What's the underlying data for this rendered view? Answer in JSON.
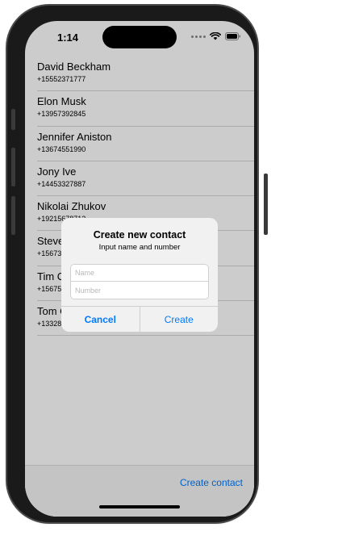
{
  "status_bar": {
    "time": "1:14"
  },
  "contacts": [
    {
      "name": "David Beckham",
      "phone": "+15552371777"
    },
    {
      "name": "Elon Musk",
      "phone": "+13957392845"
    },
    {
      "name": "Jennifer Aniston",
      "phone": "+13674551990"
    },
    {
      "name": "Jony Ive",
      "phone": "+14453327887"
    },
    {
      "name": "Nikolai Zhukov",
      "phone": "+19215678712"
    },
    {
      "name": "Steve",
      "phone": "+15673"
    },
    {
      "name": "Tim C",
      "phone": "+15675"
    },
    {
      "name": "Tom C",
      "phone": "+13328"
    }
  ],
  "toolbar": {
    "create_contact_label": "Create contact"
  },
  "alert": {
    "title": "Create new contact",
    "message": "Input name and number",
    "name_placeholder": "Name",
    "number_placeholder": "Number",
    "name_value": "",
    "number_value": "",
    "cancel_label": "Cancel",
    "create_label": "Create"
  },
  "icons": {
    "signal": "signal-dots-icon",
    "wifi": "wifi-icon",
    "battery": "battery-icon"
  },
  "colors": {
    "accent": "#007aff",
    "alert_background": "#f1f1f1",
    "dim_overlay": "rgba(0,0,0,0.20)"
  }
}
